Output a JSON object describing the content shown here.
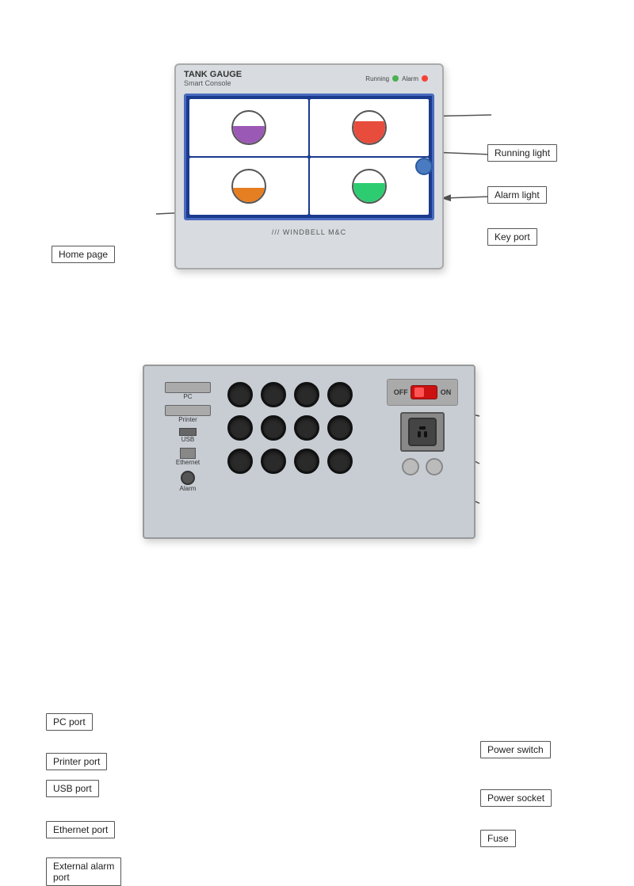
{
  "top_labels": {
    "running_light": "Running light",
    "alarm_light": "Alarm light",
    "key_port": "Key port",
    "home_page": "Home page"
  },
  "bottom_labels": {
    "pc_port": "PC port",
    "printer_port": "Printer port",
    "usb_port": "USB port",
    "ethernet_port": "Ethernet port",
    "external_alarm_port": "External alarm\nport",
    "power_switch": "Power switch",
    "power_socket": "Power socket",
    "fuse": "Fuse"
  },
  "device": {
    "title": "TANK GAUGE",
    "subtitle": "Smart Console",
    "brand": "/// WINDBELL M&C",
    "running_label": "Running",
    "alarm_label": "Alarm",
    "off_label": "OFF",
    "on_label": "ON"
  }
}
